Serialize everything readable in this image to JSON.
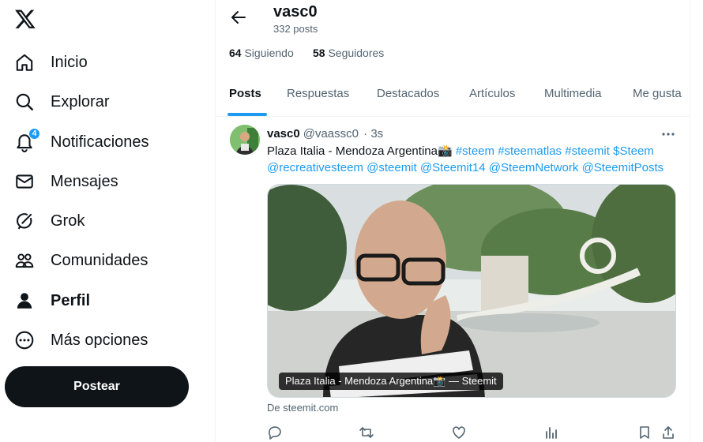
{
  "sidebar": {
    "items": [
      {
        "label": "Inicio",
        "icon": "home-icon"
      },
      {
        "label": "Explorar",
        "icon": "search-icon"
      },
      {
        "label": "Notificaciones",
        "icon": "bell-icon",
        "badge": "4"
      },
      {
        "label": "Mensajes",
        "icon": "mail-icon"
      },
      {
        "label": "Grok",
        "icon": "grok-icon"
      },
      {
        "label": "Comunidades",
        "icon": "people-icon"
      },
      {
        "label": "Perfil",
        "icon": "person-icon",
        "active": true
      },
      {
        "label": "Más opciones",
        "icon": "more-circle-icon"
      }
    ],
    "post_label": "Postear"
  },
  "profile": {
    "name": "vasc0",
    "posts_count": "332 posts",
    "following_count": "64",
    "following_label": "Siguiendo",
    "followers_count": "58",
    "followers_label": "Seguidores"
  },
  "tabs": [
    {
      "label": "Posts",
      "active": true
    },
    {
      "label": "Respuestas"
    },
    {
      "label": "Destacados"
    },
    {
      "label": "Artículos"
    },
    {
      "label": "Multimedia"
    },
    {
      "label": "Me gusta"
    }
  ],
  "tweet": {
    "name": "vasc0",
    "handle": "@vaassc0",
    "time": "· 3s",
    "text": "Plaza Italia - Mendoza Argentina📸",
    "links": [
      "#steem",
      "#steematlas",
      "#steemit",
      "$Steem",
      "@recreativesteem",
      "@steemit",
      "@Steemit14",
      "@SteemNetwork",
      "@SteemitPosts"
    ],
    "media_caption": "Plaza Italia - Mendoza Argentina📸 — Steemit",
    "source": "De steemit.com"
  },
  "colors": {
    "accent": "#1d9bf0",
    "text": "#0f1419",
    "muted": "#536471",
    "border": "#eff3f4"
  }
}
